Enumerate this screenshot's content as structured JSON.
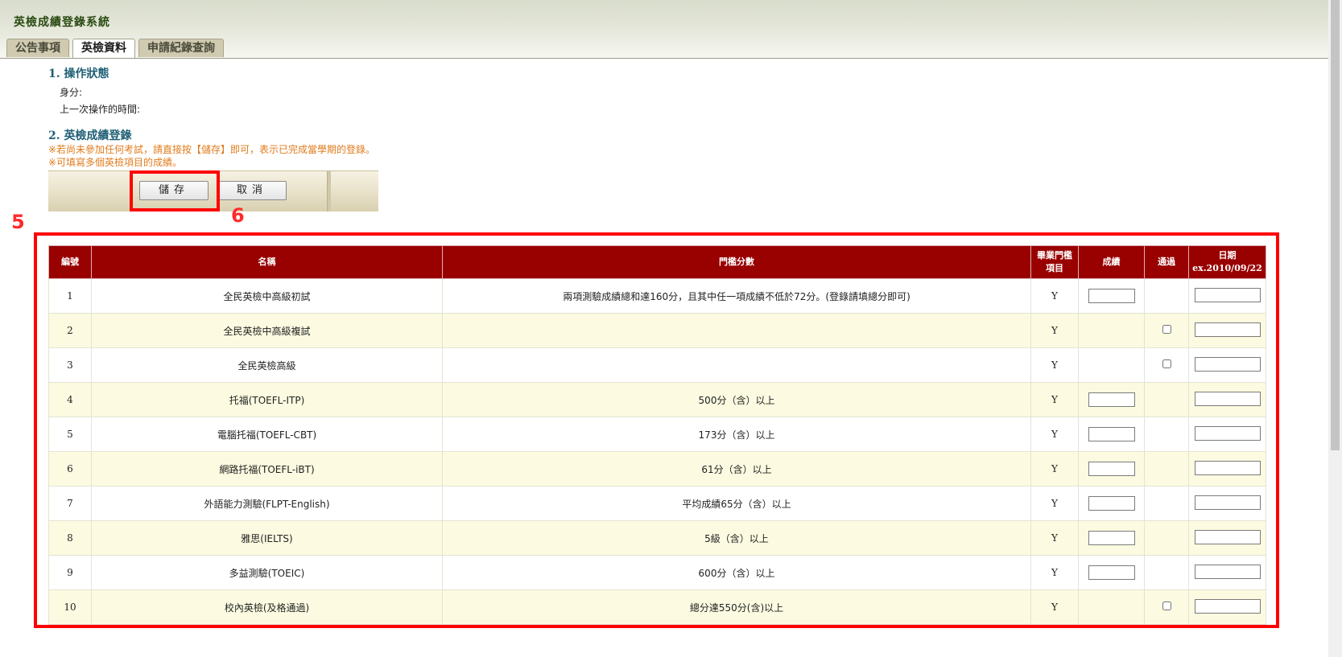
{
  "header": {
    "system_title": "英檢成績登錄系統",
    "tabs": [
      {
        "label": "公告事項",
        "active": false
      },
      {
        "label": "英檢資料",
        "active": true
      },
      {
        "label": "申請紀錄查詢",
        "active": false
      }
    ]
  },
  "status_section": {
    "title": "1. 操作狀態",
    "identity_label": "身分:",
    "last_time_label": "上一次操作的時間:"
  },
  "register_section": {
    "title": "2. 英檢成績登錄",
    "note1": "※若尚未參加任何考試，請直接按【儲存】即可，表示已完成當學期的登錄。",
    "note2": "※可填寫多個英檢項目的成績。"
  },
  "buttons": {
    "save_label": "儲存",
    "cancel_label": "取消"
  },
  "markers": {
    "table_marker": "5",
    "save_marker": "6"
  },
  "table": {
    "headers": {
      "no": "編號",
      "name": "名稱",
      "threshold": "門檻分數",
      "grad_line1": "畢業門檻",
      "grad_line2": "項目",
      "score": "成績",
      "pass": "通過",
      "date_line1": "日期",
      "date_line2": "ex.2010/09/22"
    },
    "rows": [
      {
        "no": "1",
        "name": "全民英檢中高級初試",
        "threshold": "兩項測驗成績總和達160分，且其中任一項成績不低於72分。(登錄請填總分即可)",
        "grad": "Y"
      },
      {
        "no": "2",
        "name": "全民英檢中高級複試",
        "threshold": "",
        "grad": "Y"
      },
      {
        "no": "3",
        "name": "全民英檢高級",
        "threshold": "",
        "grad": "Y"
      },
      {
        "no": "4",
        "name": "托福(TOEFL-ITP)",
        "threshold": "500分（含）以上",
        "grad": "Y"
      },
      {
        "no": "5",
        "name": "電腦托福(TOEFL-CBT)",
        "threshold": "173分（含）以上",
        "grad": "Y"
      },
      {
        "no": "6",
        "name": "網路托福(TOEFL-iBT)",
        "threshold": "61分（含）以上",
        "grad": "Y"
      },
      {
        "no": "7",
        "name": "外語能力測驗(FLPT-English)",
        "threshold": "平均成績65分（含）以上",
        "grad": "Y"
      },
      {
        "no": "8",
        "name": "雅思(IELTS)",
        "threshold": "5級（含）以上",
        "grad": "Y"
      },
      {
        "no": "9",
        "name": "多益測驗(TOEIC)",
        "threshold": "600分（含）以上",
        "grad": "Y"
      },
      {
        "no": "10",
        "name": "校內英檢(及格通過)",
        "threshold": "總分達550分(含)以上",
        "grad": "Y"
      }
    ]
  },
  "colors": {
    "header_red": "#990000",
    "alt_row": "#fcfbe1",
    "note_orange": "#e07b1c",
    "section_teal": "#1f5f75",
    "highlight_red": "#ff0000"
  }
}
